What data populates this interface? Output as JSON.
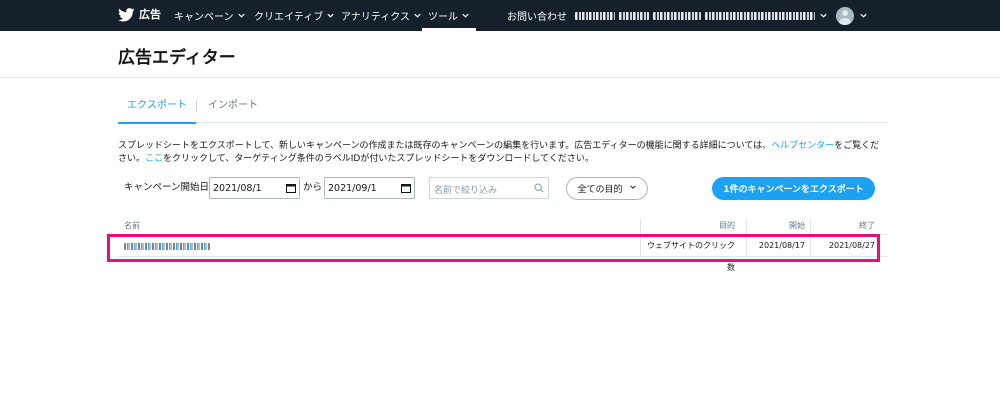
{
  "nav": {
    "brand": "広告",
    "items": [
      {
        "label": "キャンペーン"
      },
      {
        "label": "クリエイティブ"
      },
      {
        "label": "アナリティクス"
      },
      {
        "label": "ツール"
      }
    ],
    "contact": "お問い合わせ"
  },
  "page": {
    "title": "広告エディター"
  },
  "tabs": {
    "export": "エクスポート",
    "import": "インポート"
  },
  "description": {
    "part1": "スプレッドシートをエクスポートして、新しいキャンペーンの作成または既存のキャンペーンの編集を行います。広告エディターの機能に関する詳細については、",
    "link1": "ヘルプセンター",
    "part2": "をご覧ください。",
    "link2": "ここ",
    "part3": "をクリックして、ターゲティング条件のラベルIDが付いたスプレッドシートをダウンロードしてください。"
  },
  "filters": {
    "start_label": "キャンペーン開始日",
    "start_date": "2021/08/1",
    "from_label": "から",
    "end_date": "2021/09/1",
    "search_placeholder": "名前で絞り込み",
    "objective_select": "全ての目的",
    "export_button": "1件のキャンペーンをエクスポート"
  },
  "table": {
    "headers": {
      "name": "名前",
      "objective": "目的",
      "start": "開始",
      "end": "終了"
    },
    "rows": [
      {
        "objective": "ウェブサイトのクリック数",
        "start": "2021/08/17",
        "end": "2021/08/27"
      }
    ]
  },
  "colors": {
    "nav_bg": "#15202b",
    "accent": "#1da1f2",
    "highlight": "#e0137a"
  }
}
